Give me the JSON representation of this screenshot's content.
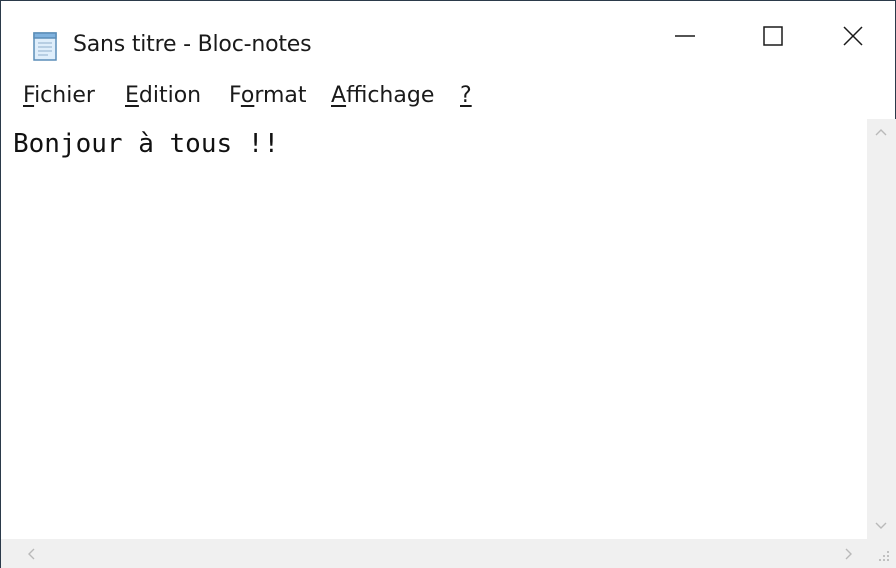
{
  "window": {
    "title": "Sans titre - Bloc-notes"
  },
  "menu": [
    {
      "underlined": "F",
      "rest": "ichier"
    },
    {
      "underlined": "E",
      "rest": "dition"
    },
    {
      "before": "F",
      "underlined": "o",
      "rest": "rmat"
    },
    {
      "underlined": "A",
      "rest": "ffichage"
    },
    {
      "underlined": "?",
      "rest": ""
    }
  ],
  "editor": {
    "content": "Bonjour à tous !!"
  },
  "icons": {
    "app": "notepad-icon",
    "minimize": "minimize-icon",
    "maximize": "maximize-icon",
    "close": "close-icon"
  }
}
